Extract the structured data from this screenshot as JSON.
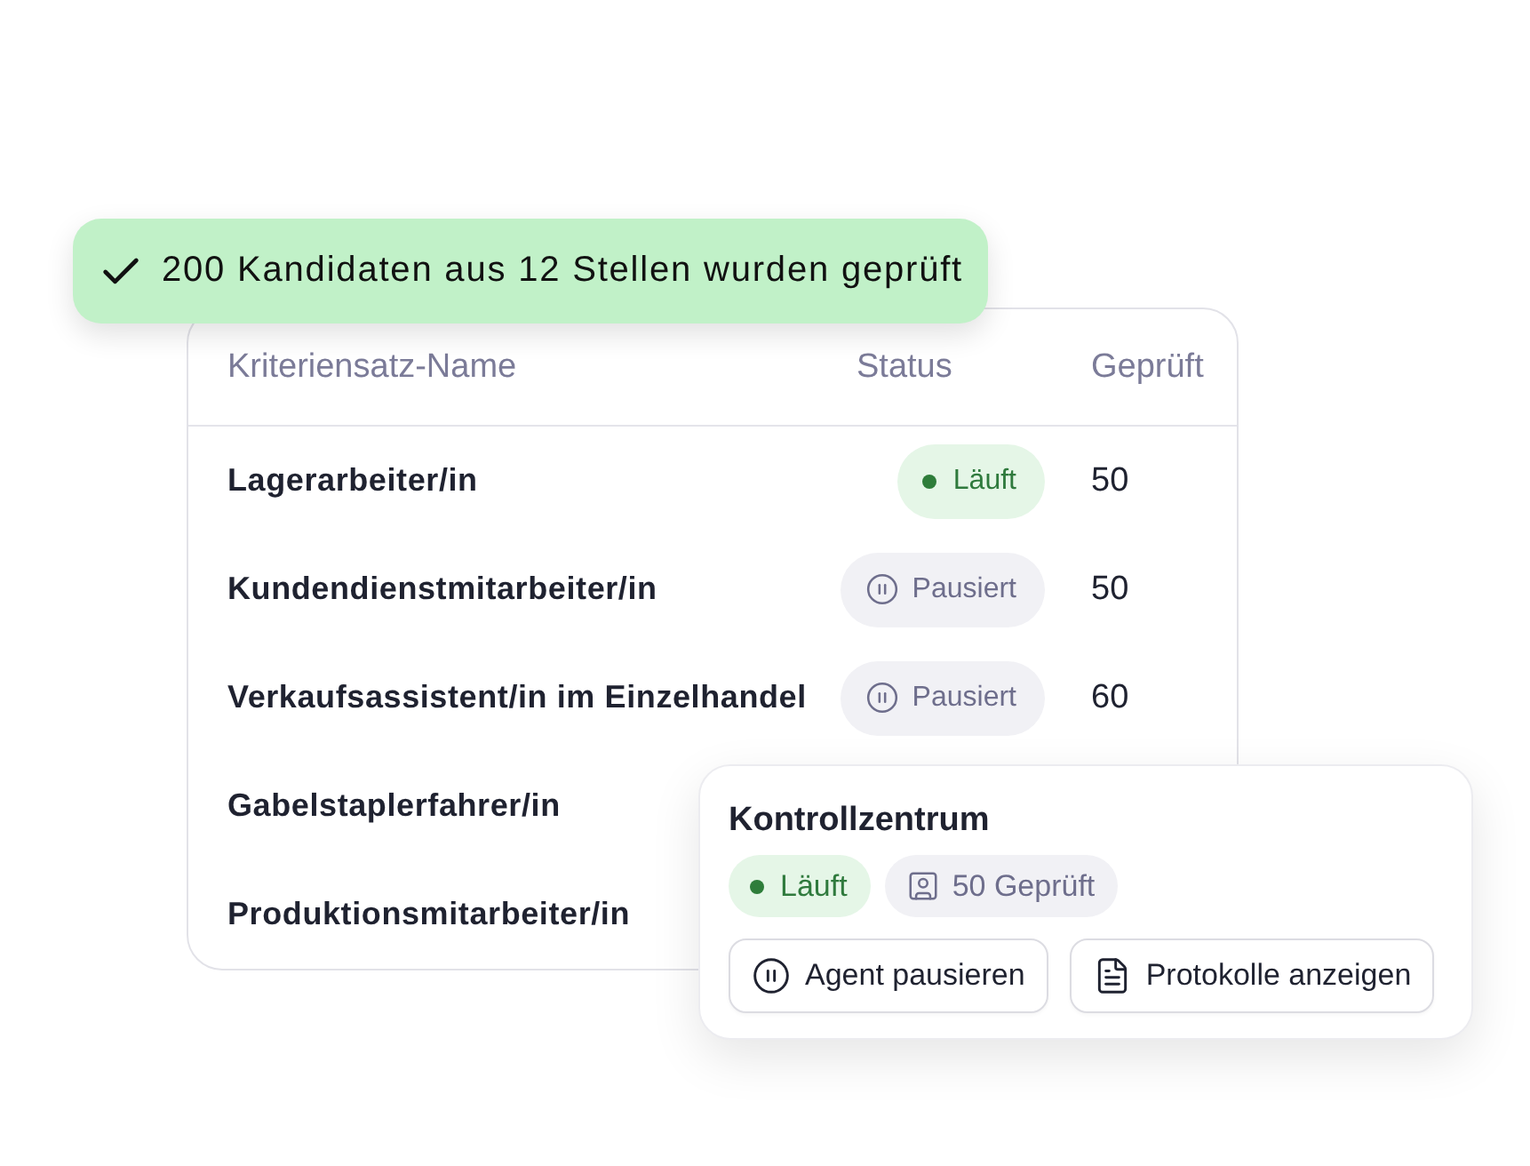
{
  "toast": {
    "text": "200 Kandidaten aus 12 Stellen wurden geprüft"
  },
  "table": {
    "columns": [
      "Kriteriensatz-Name",
      "Status",
      "Geprüft"
    ],
    "rows": [
      {
        "name": "Lagerarbeiter/in",
        "status": {
          "kind": "running",
          "label": "Läuft"
        },
        "count": "50"
      },
      {
        "name": "Kundendienstmitarbeiter/in",
        "status": {
          "kind": "paused",
          "label": "Pausiert"
        },
        "count": "50"
      },
      {
        "name": "Verkaufsassistent/in im Einzelhandel",
        "status": {
          "kind": "paused",
          "label": "Pausiert"
        },
        "count": "60"
      },
      {
        "name": "Gabelstaplerfahrer/in"
      },
      {
        "name": "Produktionsmitarbeiter/in"
      }
    ]
  },
  "control_center": {
    "title": "Kontrollzentrum",
    "status": {
      "kind": "running",
      "label": "Läuft"
    },
    "count": "50 Geprüft",
    "buttons": [
      {
        "kind": "pause",
        "label": "Agent pausieren"
      },
      {
        "kind": "logs",
        "label": "Protokolle anzeigen"
      }
    ]
  }
}
